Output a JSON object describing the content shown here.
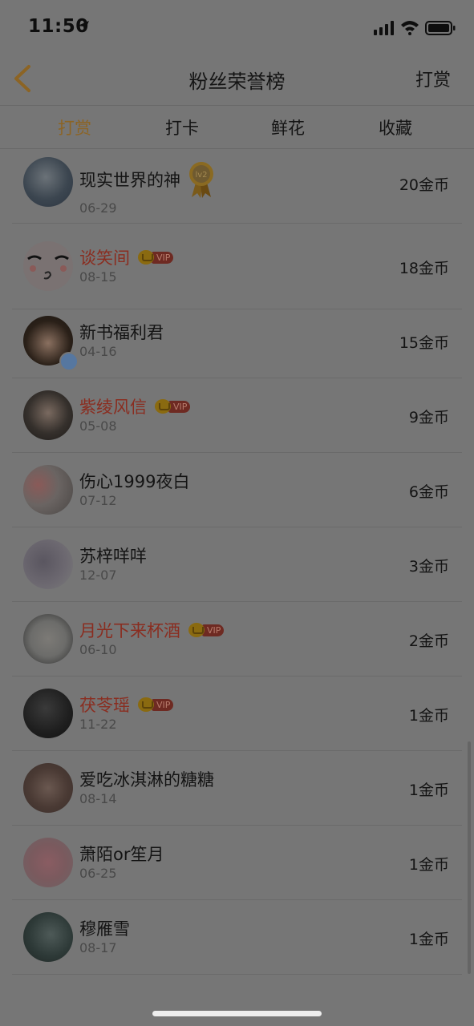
{
  "status": {
    "time": "11:50"
  },
  "nav": {
    "title": "粉丝荣誉榜",
    "right_label": "打赏"
  },
  "tabs": [
    {
      "label": "打赏",
      "active": true
    },
    {
      "label": "打卡",
      "active": false
    },
    {
      "label": "鲜花",
      "active": false
    },
    {
      "label": "收藏",
      "active": false
    }
  ],
  "vip_label": "VIP",
  "medal_label": "lv2",
  "list": [
    {
      "name": "现实世界的神",
      "date": "06-29",
      "amount": "20金币",
      "vip": false,
      "medal": true
    },
    {
      "name": "谈笑间",
      "date": "08-15",
      "amount": "18金币",
      "vip": true
    },
    {
      "name": "新书福利君",
      "date": "04-16",
      "amount": "15金币",
      "vip": false,
      "verified": true
    },
    {
      "name": "紫绫风信",
      "date": "05-08",
      "amount": "9金币",
      "vip": true
    },
    {
      "name": "伤心1999夜白",
      "date": "07-12",
      "amount": "6金币",
      "vip": false
    },
    {
      "name": "苏梓咩咩",
      "date": "12-07",
      "amount": "3金币",
      "vip": false
    },
    {
      "name": "月光下来杯酒",
      "date": "06-10",
      "amount": "2金币",
      "vip": true
    },
    {
      "name": "茯苓瑶",
      "date": "11-22",
      "amount": "1金币",
      "vip": true
    },
    {
      "name": "爱吃冰淇淋的糖糖",
      "date": "08-14",
      "amount": "1金币",
      "vip": false
    },
    {
      "name": "萧陌or笙月",
      "date": "06-25",
      "amount": "1金币",
      "vip": false
    },
    {
      "name": "穆雁雪",
      "date": "08-17",
      "amount": "1金币",
      "vip": false
    }
  ],
  "colors": {
    "overlay_bg": "#767676",
    "active_tab": "#8c6424",
    "vip_name": "#8a2d20",
    "vip_badge": "#6e2a22"
  }
}
